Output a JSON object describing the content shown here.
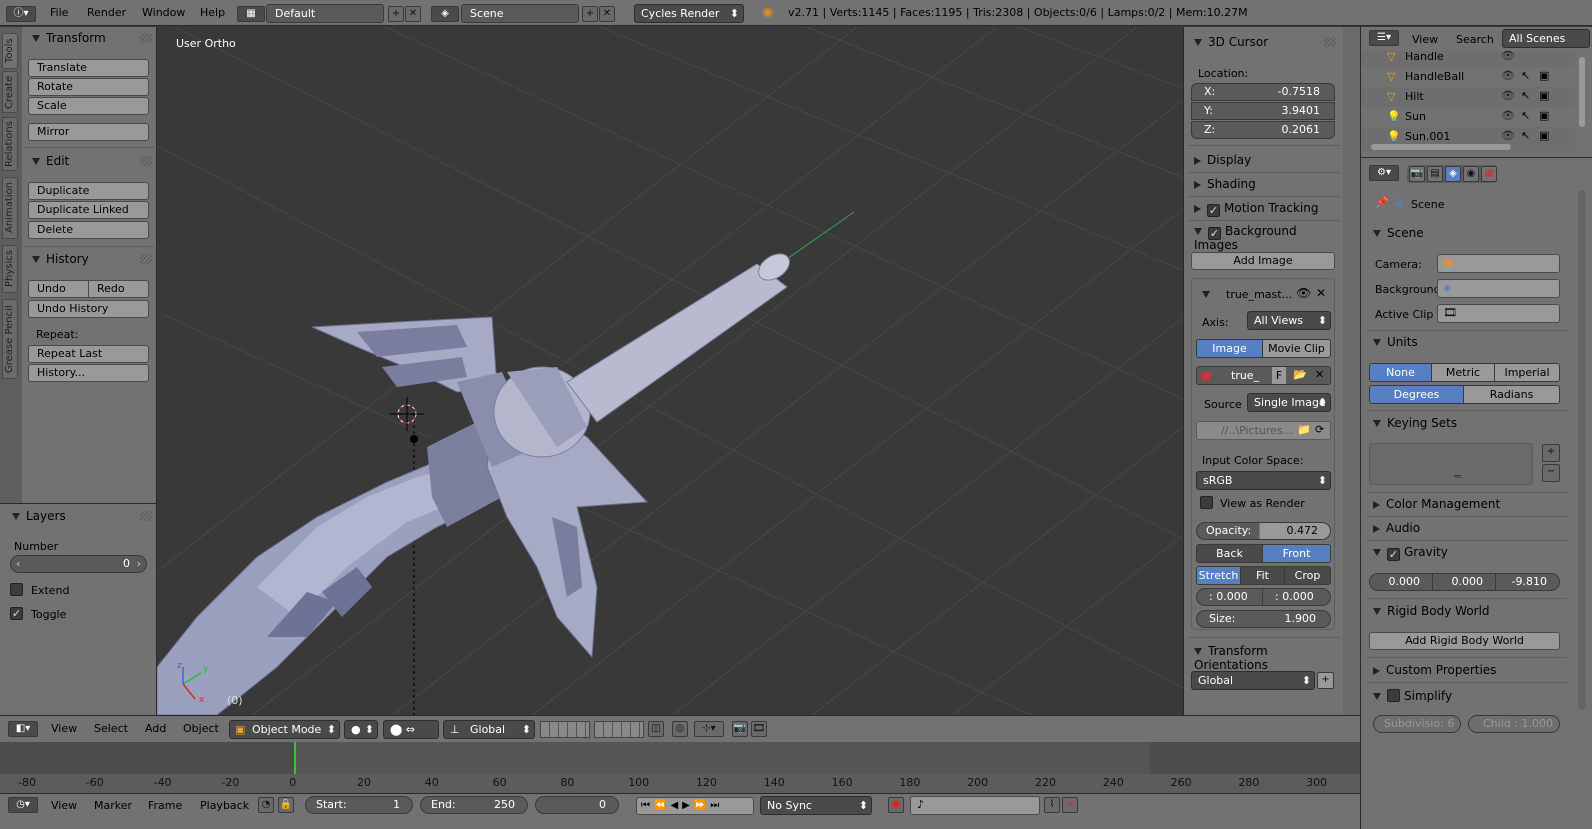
{
  "topbar": {
    "menus": [
      "File",
      "Render",
      "Window",
      "Help"
    ],
    "layout_value": "Default",
    "scene_value": "Scene",
    "engine_value": "Cycles Render",
    "stats": "v2.71 | Verts:1145 | Faces:1195 | Tris:2308 | Objects:0/6 | Lamps:0/2 | Mem:10.27M"
  },
  "left_tabs": [
    "Tools",
    "Create",
    "Relations",
    "Animation",
    "Physics",
    "Grease Pencil"
  ],
  "tools": {
    "transform_header": "Transform",
    "translate": "Translate",
    "rotate": "Rotate",
    "scale": "Scale",
    "mirror": "Mirror",
    "edit_header": "Edit",
    "duplicate": "Duplicate",
    "duplicate_linked": "Duplicate Linked",
    "delete": "Delete",
    "history_header": "History",
    "undo": "Undo",
    "redo": "Redo",
    "undo_history": "Undo History",
    "repeat_label": "Repeat:",
    "repeat_last": "Repeat Last",
    "history_menu": "History..."
  },
  "layers": {
    "header": "Layers",
    "number_label": "Number",
    "number_value": "0",
    "extend": "Extend",
    "toggle": "Toggle",
    "toggle_checked": true
  },
  "viewport": {
    "view_name": "User Ortho",
    "frame_indicator": "(0)",
    "axis_z": "z",
    "axis_y": "y",
    "axis_x": "x"
  },
  "view_header": {
    "menus": [
      "View",
      "Select",
      "Add",
      "Object"
    ],
    "mode": "Object Mode",
    "orientation": "Global"
  },
  "properties_n": {
    "cursor_header": "3D Cursor",
    "location_label": "Location:",
    "x_label": "X:",
    "x_value": "-0.7518",
    "y_label": "Y:",
    "y_value": "3.9401",
    "z_label": "Z:",
    "z_value": "0.2061",
    "display": "Display",
    "shading": "Shading",
    "motion_tracking": "Motion Tracking",
    "background_images": "Background Images",
    "add_image": "Add Image",
    "image_name": "true_mast...",
    "axis_label": "Axis:",
    "axis_value": "All Views",
    "image_tab": "Image",
    "movie_clip_tab": "Movie Clip",
    "image_field": "true_",
    "image_f": "F",
    "source_label": "Source",
    "source_value": "Single Image",
    "filepath": "//..\\Pictures...",
    "color_space_label": "Input Color Space:",
    "color_space_value": "sRGB",
    "view_as_render": "View as Render",
    "opacity_label": "Opacity:",
    "opacity_value": "0.472",
    "back": "Back",
    "front": "Front",
    "stretch": "Stretch",
    "fit": "Fit",
    "crop": "Crop",
    "offset_x": ": 0.000",
    "offset_y": ": 0.000",
    "size_label": "Size:",
    "size_value": "1.900",
    "transform_orientations": "Transform Orientations",
    "orientation_value": "Global"
  },
  "outliner": {
    "menus": [
      "View",
      "Search"
    ],
    "scope": "All Scenes",
    "items": [
      "Handle",
      "HandleBall",
      "Hilt",
      "Sun",
      "Sun.001"
    ]
  },
  "scene_props": {
    "breadcrumb": "Scene",
    "scene_header": "Scene",
    "camera_label": "Camera:",
    "background_label": "Background",
    "active_clip_label": "Active Clip",
    "units_header": "Units",
    "none": "None",
    "metric": "Metric",
    "imperial": "Imperial",
    "degrees": "Degrees",
    "radians": "Radians",
    "keying_sets_header": "Keying Sets",
    "color_management": "Color Management",
    "audio": "Audio",
    "gravity": "Gravity",
    "gravity_x": "0.000",
    "gravity_y": "0.000",
    "gravity_z": "-9.810",
    "rigid_body_world": "Rigid Body World",
    "add_rigid_body_world": "Add Rigid Body World",
    "custom_properties": "Custom Properties",
    "simplify": "Simplify",
    "subdivision": "Subdivisio: 6",
    "child": "Child : 1.000"
  },
  "timeline": {
    "ticks": [
      "-80",
      "-60",
      "-40",
      "-20",
      "0",
      "20",
      "40",
      "60",
      "80",
      "100",
      "120",
      "140",
      "160",
      "180",
      "200",
      "220",
      "240",
      "260",
      "280",
      "300"
    ],
    "menus": [
      "View",
      "Marker",
      "Frame",
      "Playback"
    ],
    "start_label": "Start:",
    "start_value": "1",
    "end_label": "End:",
    "end_value": "250",
    "current_frame": "0",
    "sync": "No Sync"
  },
  "colors": {
    "accent": "#5680c2",
    "panel": "#727272",
    "viewport": "#393939"
  }
}
